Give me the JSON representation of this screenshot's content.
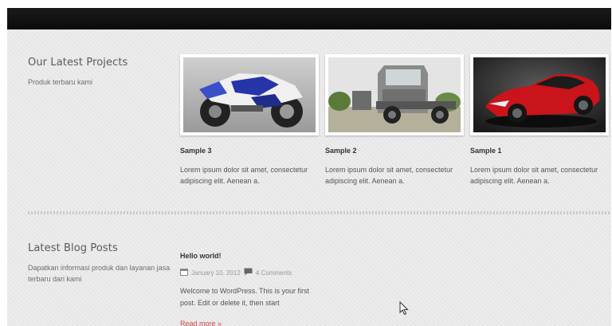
{
  "projects_section": {
    "title": "Our Latest Projects",
    "subtitle": "Produk terbaru kami",
    "items": [
      {
        "title": "Sample 3",
        "description": "Lorem ipsum dolor sit amet, consectetur adipiscing elit. Aenean a.",
        "image": "motorcycle"
      },
      {
        "title": "Sample 2",
        "description": "Lorem ipsum dolor sit amet, consectetur adipiscing elit. Aenean a.",
        "image": "truck"
      },
      {
        "title": "Sample 1",
        "description": "Lorem ipsum dolor sit amet, consectetur adipiscing elit. Aenean a.",
        "image": "red-car"
      }
    ]
  },
  "blog_section": {
    "title": "Latest Blog Posts",
    "subtitle": "Dapatkan informasi produk dan layanan jasa terbaru dari kami",
    "post": {
      "title": "Hello world!",
      "date": "January 10, 2012",
      "comments": "4 Comments",
      "excerpt": "Welcome to WordPress. This is your first post. Edit or delete it, then start",
      "read_more": "Read more »"
    }
  },
  "icons": {
    "calendar": "calendar-icon",
    "comments": "comment-icon",
    "cursor": "mouse-cursor-icon"
  },
  "colors": {
    "top_bar": "#111111",
    "background": "#ebebeb",
    "link": "#d04848"
  }
}
